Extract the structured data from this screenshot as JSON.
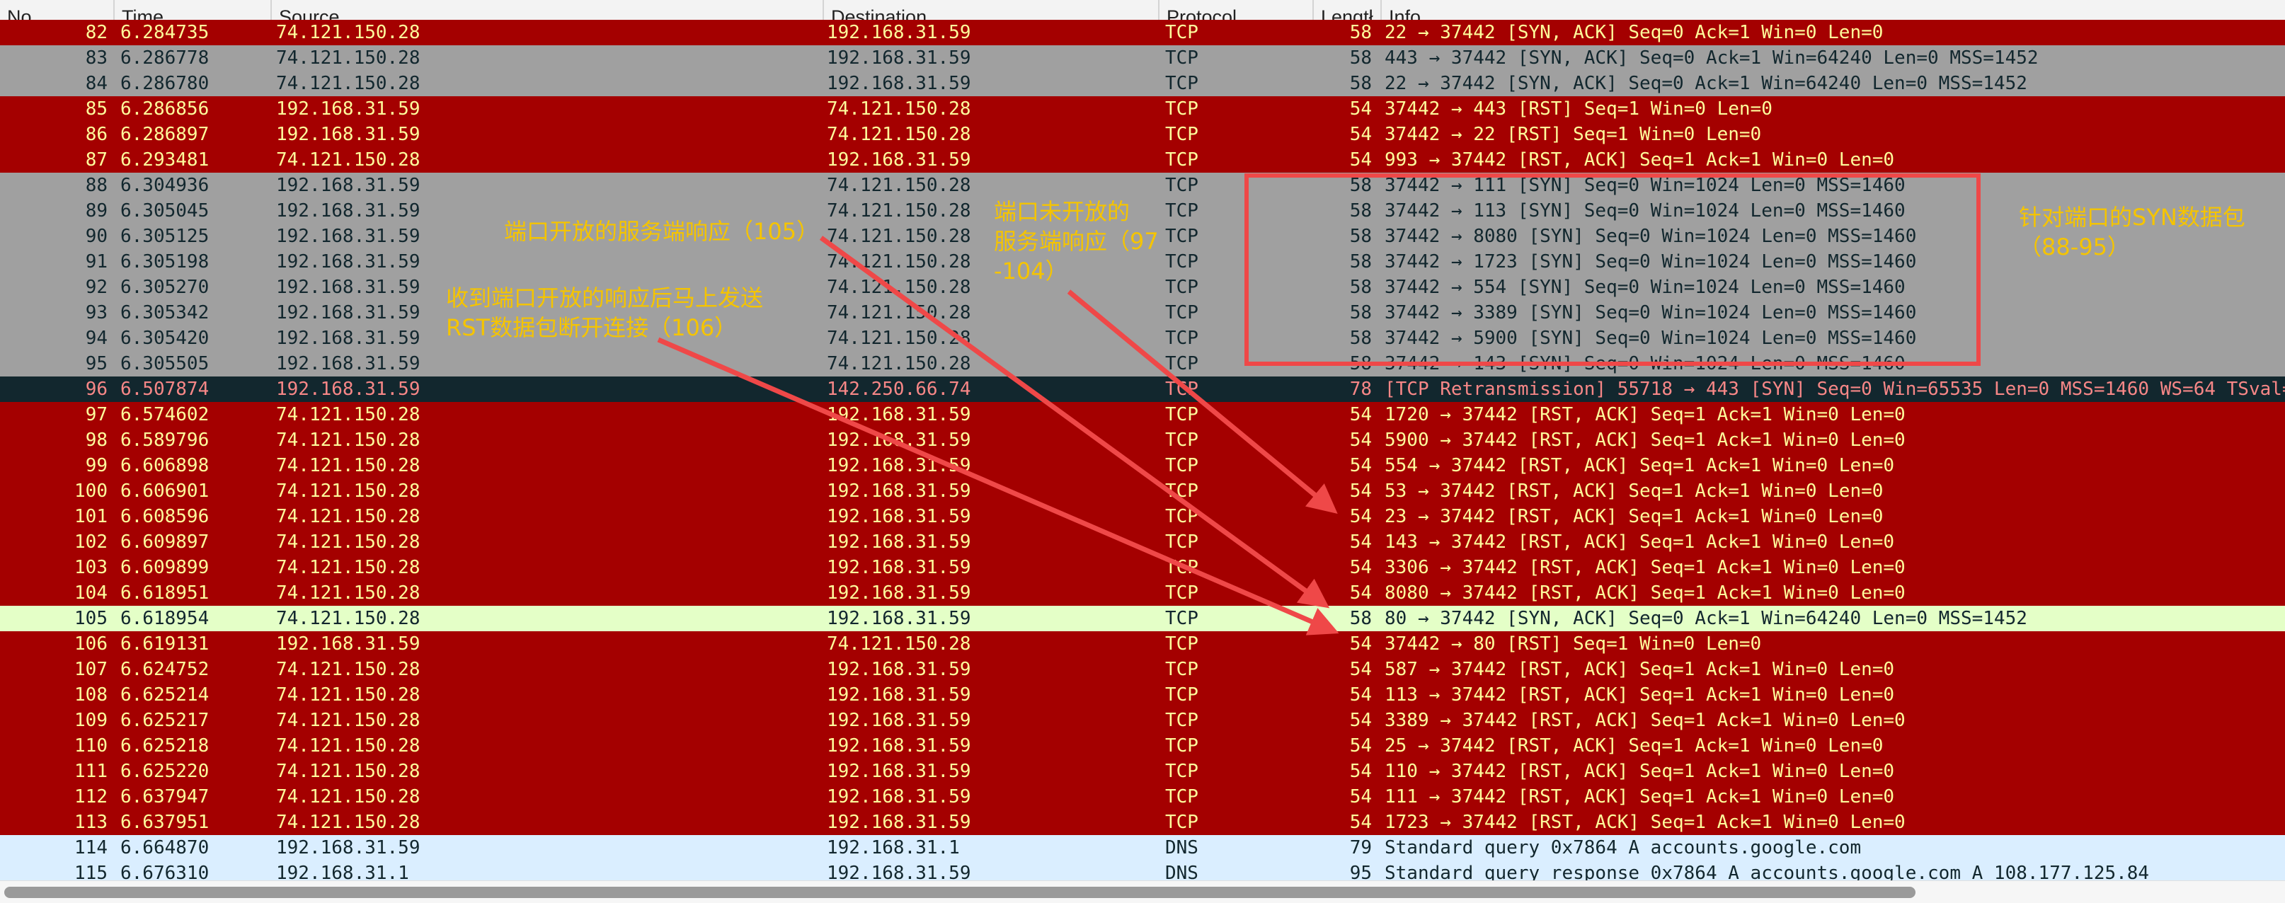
{
  "columns": {
    "no": "No.",
    "time": "Time",
    "source": "Source",
    "destination": "Destination",
    "protocol": "Protocol",
    "length": "Lengtł",
    "info": "Info"
  },
  "row_colors": {
    "red": "#a40000",
    "gray": "#a0a0a0",
    "dark": "#12272e",
    "green": "#e4ffc7",
    "blue": "#daeeff"
  },
  "packets": [
    {
      "no": "82",
      "time": "6.284735",
      "src": "74.121.150.28",
      "dst": "192.168.31.59",
      "proto": "TCP",
      "len": "58",
      "info": "22 → 37442 [SYN, ACK] Seq=0 Ack=1 Win=0 Len=0",
      "style": "red"
    },
    {
      "no": "83",
      "time": "6.286778",
      "src": "74.121.150.28",
      "dst": "192.168.31.59",
      "proto": "TCP",
      "len": "58",
      "info": "443 → 37442 [SYN, ACK] Seq=0 Ack=1 Win=64240 Len=0 MSS=1452",
      "style": "gray"
    },
    {
      "no": "84",
      "time": "6.286780",
      "src": "74.121.150.28",
      "dst": "192.168.31.59",
      "proto": "TCP",
      "len": "58",
      "info": "22 → 37442 [SYN, ACK] Seq=0 Ack=1 Win=64240 Len=0 MSS=1452",
      "style": "gray"
    },
    {
      "no": "85",
      "time": "6.286856",
      "src": "192.168.31.59",
      "dst": "74.121.150.28",
      "proto": "TCP",
      "len": "54",
      "info": "37442 → 443 [RST] Seq=1 Win=0 Len=0",
      "style": "red"
    },
    {
      "no": "86",
      "time": "6.286897",
      "src": "192.168.31.59",
      "dst": "74.121.150.28",
      "proto": "TCP",
      "len": "54",
      "info": "37442 → 22 [RST] Seq=1 Win=0 Len=0",
      "style": "red"
    },
    {
      "no": "87",
      "time": "6.293481",
      "src": "74.121.150.28",
      "dst": "192.168.31.59",
      "proto": "TCP",
      "len": "54",
      "info": "993 → 37442 [RST, ACK] Seq=1 Ack=1 Win=0 Len=0",
      "style": "red"
    },
    {
      "no": "88",
      "time": "6.304936",
      "src": "192.168.31.59",
      "dst": "74.121.150.28",
      "proto": "TCP",
      "len": "58",
      "info": "37442 → 111 [SYN] Seq=0 Win=1024 Len=0 MSS=1460",
      "style": "gray"
    },
    {
      "no": "89",
      "time": "6.305045",
      "src": "192.168.31.59",
      "dst": "74.121.150.28",
      "proto": "TCP",
      "len": "58",
      "info": "37442 → 113 [SYN] Seq=0 Win=1024 Len=0 MSS=1460",
      "style": "gray"
    },
    {
      "no": "90",
      "time": "6.305125",
      "src": "192.168.31.59",
      "dst": "74.121.150.28",
      "proto": "TCP",
      "len": "58",
      "info": "37442 → 8080 [SYN] Seq=0 Win=1024 Len=0 MSS=1460",
      "style": "gray"
    },
    {
      "no": "91",
      "time": "6.305198",
      "src": "192.168.31.59",
      "dst": "74.121.150.28",
      "proto": "TCP",
      "len": "58",
      "info": "37442 → 1723 [SYN] Seq=0 Win=1024 Len=0 MSS=1460",
      "style": "gray"
    },
    {
      "no": "92",
      "time": "6.305270",
      "src": "192.168.31.59",
      "dst": "74.121.150.28",
      "proto": "TCP",
      "len": "58",
      "info": "37442 → 554 [SYN] Seq=0 Win=1024 Len=0 MSS=1460",
      "style": "gray"
    },
    {
      "no": "93",
      "time": "6.305342",
      "src": "192.168.31.59",
      "dst": "74.121.150.28",
      "proto": "TCP",
      "len": "58",
      "info": "37442 → 3389 [SYN] Seq=0 Win=1024 Len=0 MSS=1460",
      "style": "gray"
    },
    {
      "no": "94",
      "time": "6.305420",
      "src": "192.168.31.59",
      "dst": "74.121.150.28",
      "proto": "TCP",
      "len": "58",
      "info": "37442 → 5900 [SYN] Seq=0 Win=1024 Len=0 MSS=1460",
      "style": "gray"
    },
    {
      "no": "95",
      "time": "6.305505",
      "src": "192.168.31.59",
      "dst": "74.121.150.28",
      "proto": "TCP",
      "len": "58",
      "info": "37442 → 143 [SYN] Seq=0 Win=1024 Len=0 MSS=1460",
      "style": "gray"
    },
    {
      "no": "96",
      "time": "6.507874",
      "src": "192.168.31.59",
      "dst": "142.250.66.74",
      "proto": "TCP",
      "len": "78",
      "info": "[TCP Retransmission] 55718 → 443 [SYN] Seq=0 Win=65535 Len=0 MSS=1460 WS=64 TSval=",
      "style": "dark"
    },
    {
      "no": "97",
      "time": "6.574602",
      "src": "74.121.150.28",
      "dst": "192.168.31.59",
      "proto": "TCP",
      "len": "54",
      "info": "1720 → 37442 [RST, ACK] Seq=1 Ack=1 Win=0 Len=0",
      "style": "red"
    },
    {
      "no": "98",
      "time": "6.589796",
      "src": "74.121.150.28",
      "dst": "192.168.31.59",
      "proto": "TCP",
      "len": "54",
      "info": "5900 → 37442 [RST, ACK] Seq=1 Ack=1 Win=0 Len=0",
      "style": "red"
    },
    {
      "no": "99",
      "time": "6.606898",
      "src": "74.121.150.28",
      "dst": "192.168.31.59",
      "proto": "TCP",
      "len": "54",
      "info": "554 → 37442 [RST, ACK] Seq=1 Ack=1 Win=0 Len=0",
      "style": "red"
    },
    {
      "no": "100",
      "time": "6.606901",
      "src": "74.121.150.28",
      "dst": "192.168.31.59",
      "proto": "TCP",
      "len": "54",
      "info": "53 → 37442 [RST, ACK] Seq=1 Ack=1 Win=0 Len=0",
      "style": "red"
    },
    {
      "no": "101",
      "time": "6.608596",
      "src": "74.121.150.28",
      "dst": "192.168.31.59",
      "proto": "TCP",
      "len": "54",
      "info": "23 → 37442 [RST, ACK] Seq=1 Ack=1 Win=0 Len=0",
      "style": "red"
    },
    {
      "no": "102",
      "time": "6.609897",
      "src": "74.121.150.28",
      "dst": "192.168.31.59",
      "proto": "TCP",
      "len": "54",
      "info": "143 → 37442 [RST, ACK] Seq=1 Ack=1 Win=0 Len=0",
      "style": "red"
    },
    {
      "no": "103",
      "time": "6.609899",
      "src": "74.121.150.28",
      "dst": "192.168.31.59",
      "proto": "TCP",
      "len": "54",
      "info": "3306 → 37442 [RST, ACK] Seq=1 Ack=1 Win=0 Len=0",
      "style": "red"
    },
    {
      "no": "104",
      "time": "6.618951",
      "src": "74.121.150.28",
      "dst": "192.168.31.59",
      "proto": "TCP",
      "len": "54",
      "info": "8080 → 37442 [RST, ACK] Seq=1 Ack=1 Win=0 Len=0",
      "style": "red"
    },
    {
      "no": "105",
      "time": "6.618954",
      "src": "74.121.150.28",
      "dst": "192.168.31.59",
      "proto": "TCP",
      "len": "58",
      "info": "80 → 37442 [SYN, ACK] Seq=0 Ack=1 Win=64240 Len=0 MSS=1452",
      "style": "green"
    },
    {
      "no": "106",
      "time": "6.619131",
      "src": "192.168.31.59",
      "dst": "74.121.150.28",
      "proto": "TCP",
      "len": "54",
      "info": "37442 → 80 [RST] Seq=1 Win=0 Len=0",
      "style": "red"
    },
    {
      "no": "107",
      "time": "6.624752",
      "src": "74.121.150.28",
      "dst": "192.168.31.59",
      "proto": "TCP",
      "len": "54",
      "info": "587 → 37442 [RST, ACK] Seq=1 Ack=1 Win=0 Len=0",
      "style": "red"
    },
    {
      "no": "108",
      "time": "6.625214",
      "src": "74.121.150.28",
      "dst": "192.168.31.59",
      "proto": "TCP",
      "len": "54",
      "info": "113 → 37442 [RST, ACK] Seq=1 Ack=1 Win=0 Len=0",
      "style": "red"
    },
    {
      "no": "109",
      "time": "6.625217",
      "src": "74.121.150.28",
      "dst": "192.168.31.59",
      "proto": "TCP",
      "len": "54",
      "info": "3389 → 37442 [RST, ACK] Seq=1 Ack=1 Win=0 Len=0",
      "style": "red"
    },
    {
      "no": "110",
      "time": "6.625218",
      "src": "74.121.150.28",
      "dst": "192.168.31.59",
      "proto": "TCP",
      "len": "54",
      "info": "25 → 37442 [RST, ACK] Seq=1 Ack=1 Win=0 Len=0",
      "style": "red"
    },
    {
      "no": "111",
      "time": "6.625220",
      "src": "74.121.150.28",
      "dst": "192.168.31.59",
      "proto": "TCP",
      "len": "54",
      "info": "110 → 37442 [RST, ACK] Seq=1 Ack=1 Win=0 Len=0",
      "style": "red"
    },
    {
      "no": "112",
      "time": "6.637947",
      "src": "74.121.150.28",
      "dst": "192.168.31.59",
      "proto": "TCP",
      "len": "54",
      "info": "111 → 37442 [RST, ACK] Seq=1 Ack=1 Win=0 Len=0",
      "style": "red"
    },
    {
      "no": "113",
      "time": "6.637951",
      "src": "74.121.150.28",
      "dst": "192.168.31.59",
      "proto": "TCP",
      "len": "54",
      "info": "1723 → 37442 [RST, ACK] Seq=1 Ack=1 Win=0 Len=0",
      "style": "red"
    },
    {
      "no": "114",
      "time": "6.664870",
      "src": "192.168.31.59",
      "dst": "192.168.31.1",
      "proto": "DNS",
      "len": "79",
      "info": "Standard query 0x7864 A accounts.google.com",
      "style": "blue"
    },
    {
      "no": "115",
      "time": "6.676310",
      "src": "192.168.31.1",
      "dst": "192.168.31.59",
      "proto": "DNS",
      "len": "95",
      "info": "Standard query response 0x7864 A accounts.google.com A 108.177.125.84",
      "style": "blue"
    }
  ],
  "annotations": {
    "open_port_response": "端口开放的服务端响应（105）",
    "closed_port_line1": "端口未开放的",
    "closed_port_line2": "服务端响应（97",
    "closed_port_line3": "-104）",
    "rst_after_open_line1": "收到端口开放的响应后马上发送",
    "rst_after_open_line2": "RST数据包断开连接（106）",
    "syn_probe_line1": "针对端口的SYN数据包",
    "syn_probe_line2": "（88-95）",
    "color": "#f5c400",
    "arrow_color": "#ef4848"
  }
}
